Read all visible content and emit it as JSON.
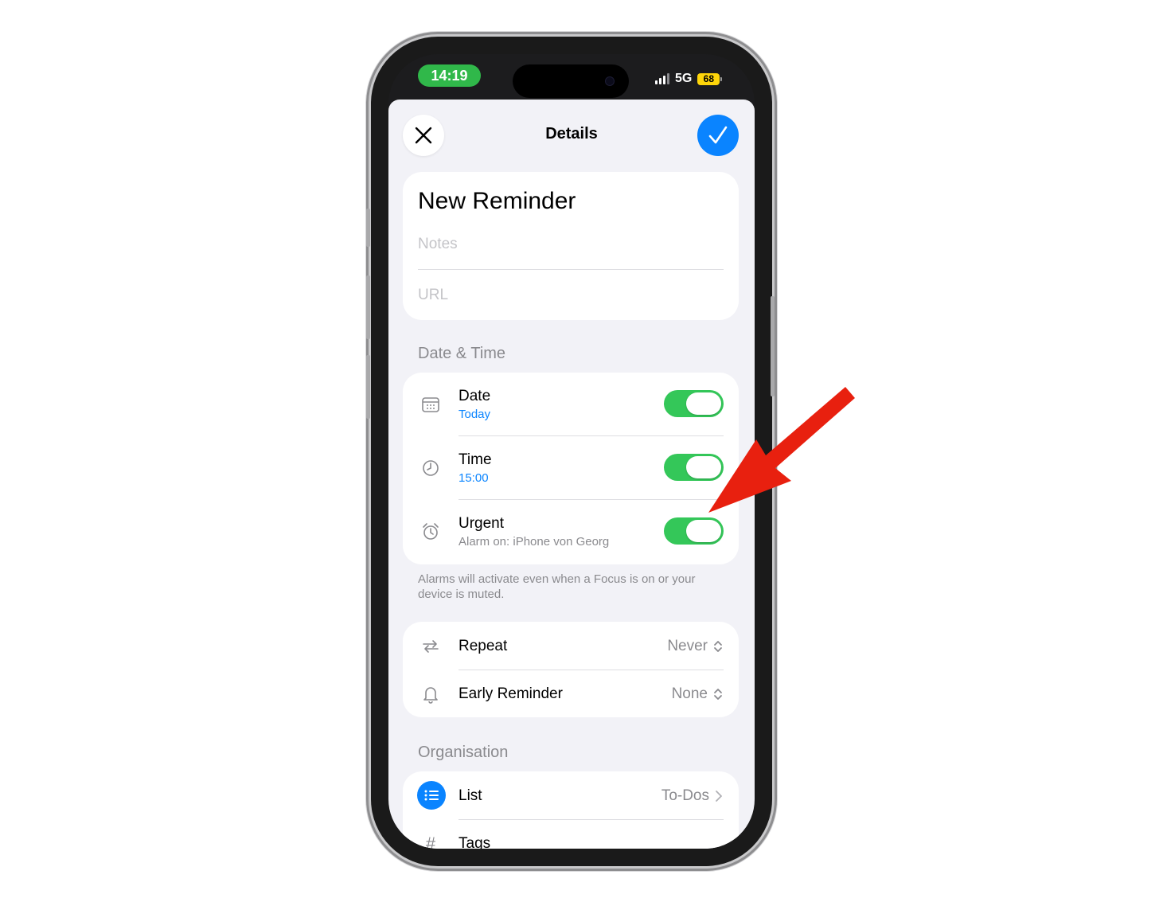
{
  "status_bar": {
    "time": "14:19",
    "network": "5G",
    "battery": "68"
  },
  "nav": {
    "title": "Details",
    "close_icon": "close-icon",
    "done_icon": "checkmark-icon"
  },
  "reminder": {
    "title": "New Reminder",
    "notes_placeholder": "Notes",
    "url_placeholder": "URL"
  },
  "date_time": {
    "header": "Date & Time",
    "date": {
      "label": "Date",
      "value": "Today",
      "on": true
    },
    "time": {
      "label": "Time",
      "value": "15:00",
      "on": true
    },
    "urgent": {
      "label": "Urgent",
      "value": "Alarm on: iPhone von Georg",
      "on": true
    },
    "footnote": "Alarms will activate even when a Focus is on or your device is muted."
  },
  "repeat": {
    "repeat": {
      "label": "Repeat",
      "value": "Never"
    },
    "early_reminder": {
      "label": "Early Reminder",
      "value": "None"
    }
  },
  "organisation": {
    "header": "Organisation",
    "list": {
      "label": "List",
      "value": "To-Dos"
    },
    "tags": {
      "label": "Tags"
    }
  },
  "colors": {
    "accent": "#0a84ff",
    "toggle_on": "#34c759",
    "time_pill": "#30b84a",
    "battery": "#ffd60a",
    "annotation_arrow": "#e8200f"
  }
}
